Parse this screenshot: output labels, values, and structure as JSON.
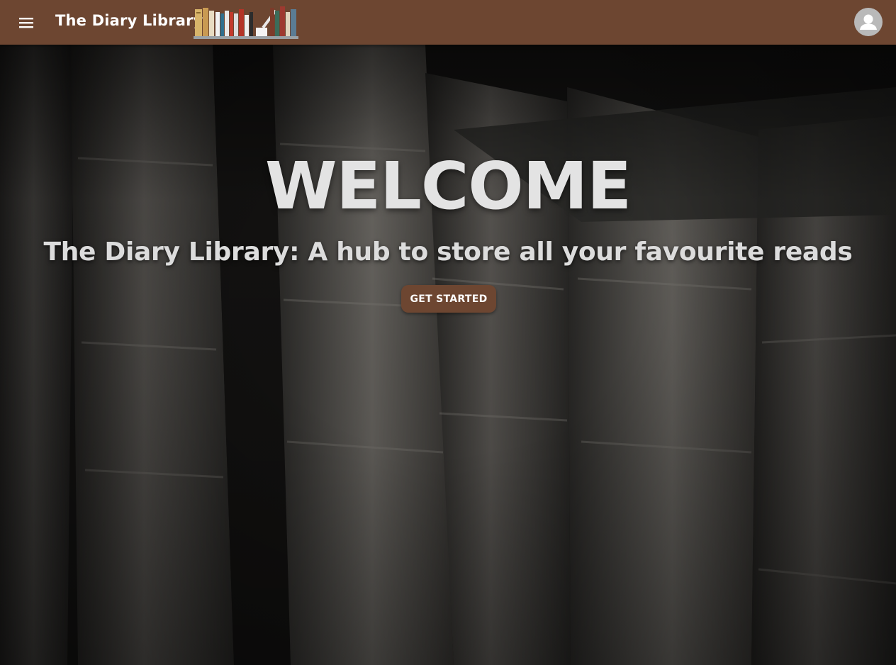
{
  "header": {
    "menu_icon": "hamburger-menu-icon",
    "title": "The Diary Library",
    "logo_icon": "bookshelf-logo-icon",
    "account_icon": "account-avatar-icon"
  },
  "hero": {
    "background": "old-books-spines-photo",
    "heading": "WELCOME",
    "tagline": "The Diary Library: A hub to store all your favourite reads",
    "cta_label": "GET STARTED"
  },
  "colors": {
    "appbar": "#6d4631",
    "button": "#6d4631",
    "heading_text": "#e3e3e3",
    "avatar_bg": "#b9b9b9"
  }
}
